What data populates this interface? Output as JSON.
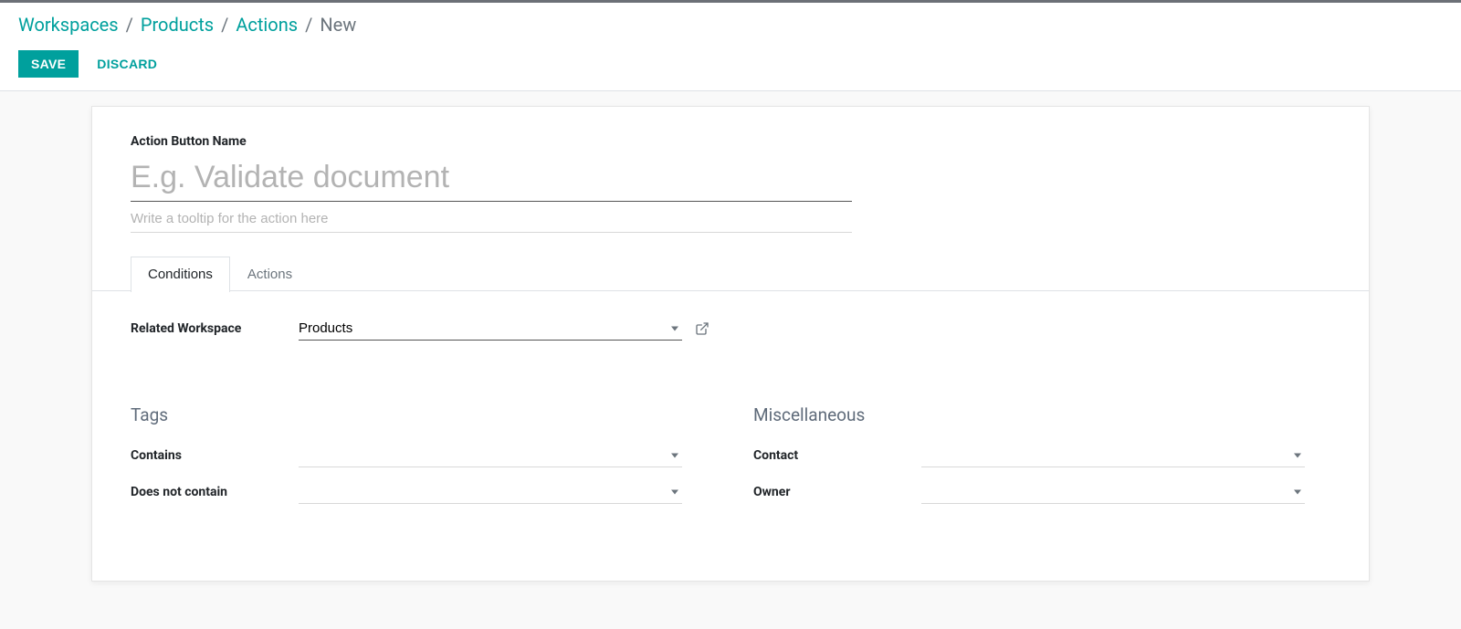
{
  "breadcrumb": {
    "items": [
      "Workspaces",
      "Products",
      "Actions"
    ],
    "current": "New",
    "separator": "/"
  },
  "controls": {
    "save": "SAVE",
    "discard": "DISCARD"
  },
  "form": {
    "title_label": "Action Button Name",
    "title_value": "",
    "title_placeholder": "E.g. Validate document",
    "tooltip_value": "",
    "tooltip_placeholder": "Write a tooltip for the action here"
  },
  "tabs": {
    "conditions": "Conditions",
    "actions": "Actions"
  },
  "conditions": {
    "related_workspace_label": "Related Workspace",
    "related_workspace_value": "Products",
    "tags_group": "Tags",
    "contains_label": "Contains",
    "contains_value": "",
    "not_contain_label": "Does not contain",
    "not_contain_value": "",
    "misc_group": "Miscellaneous",
    "contact_label": "Contact",
    "contact_value": "",
    "owner_label": "Owner",
    "owner_value": ""
  }
}
